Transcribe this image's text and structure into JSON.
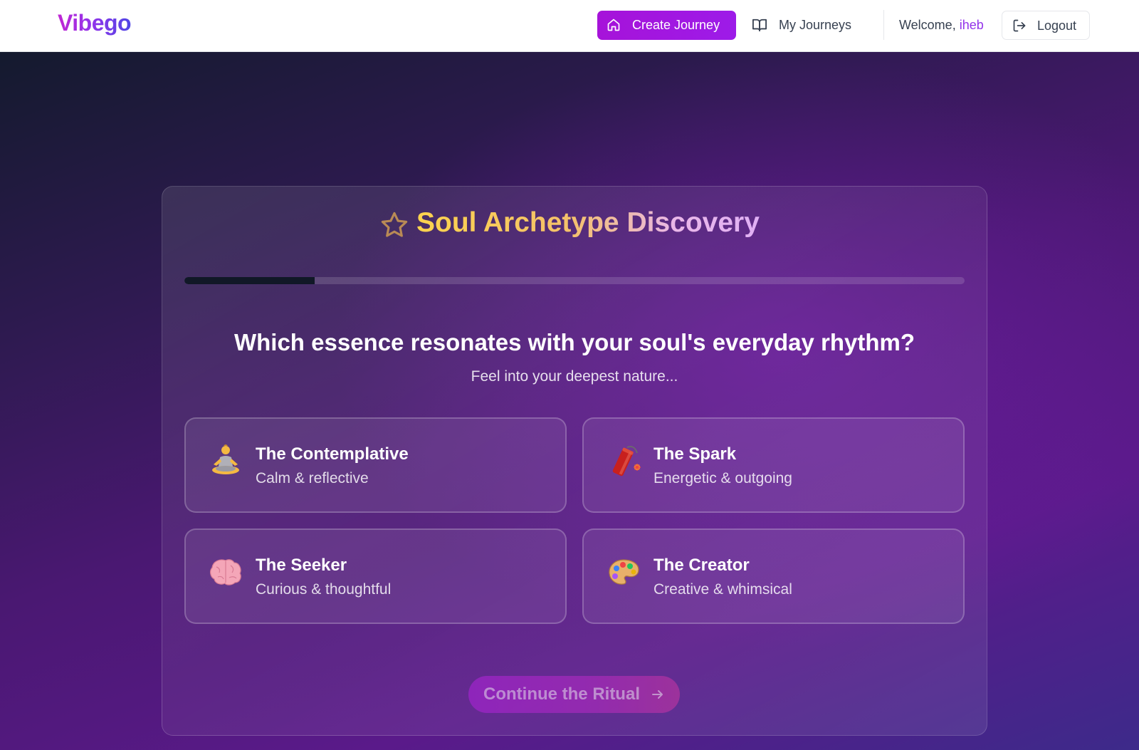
{
  "app": {
    "logo": "Vibego"
  },
  "nav": {
    "create_label": "Create Journey",
    "journeys_label": "My Journeys",
    "welcome_prefix": "Welcome, ",
    "username": "iheb",
    "logout_label": "Logout"
  },
  "quiz": {
    "title": "Soul Archetype Discovery",
    "progress": 0.1667,
    "question": "Which essence resonates with your soul's everyday rhythm?",
    "subtext": "Feel into your deepest nature...",
    "options": [
      {
        "name": "The Contemplative",
        "desc": "Calm & reflective",
        "icon": "meditation-icon"
      },
      {
        "name": "The Spark",
        "desc": "Energetic & outgoing",
        "icon": "firecracker-icon"
      },
      {
        "name": "The Seeker",
        "desc": "Curious & thoughtful",
        "icon": "brain-icon"
      },
      {
        "name": "The Creator",
        "desc": "Creative & whimsical",
        "icon": "palette-icon"
      }
    ],
    "continue_label": "Continue the Ritual"
  },
  "colors": {
    "accent": "#9d1be8",
    "username": "#9333ea",
    "title_gold": "#fcd34d",
    "progress_fill": "#111827"
  }
}
